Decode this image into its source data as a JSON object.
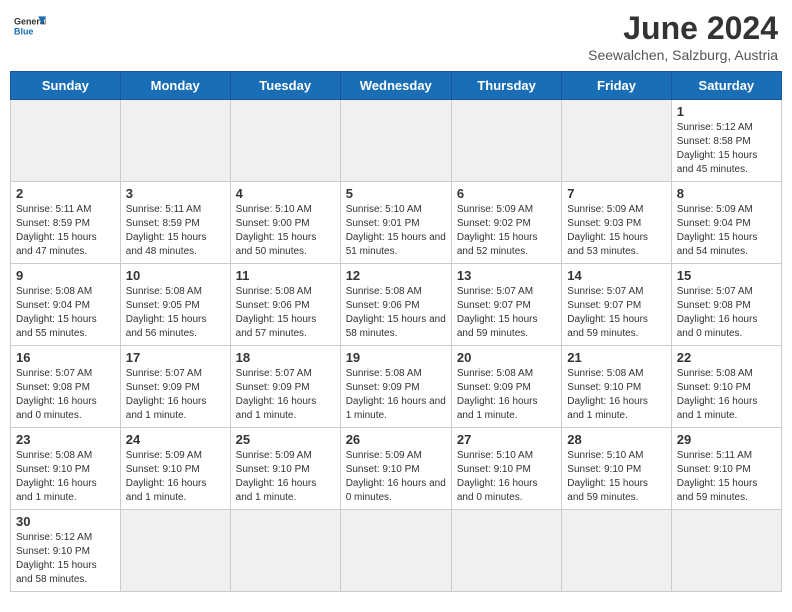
{
  "header": {
    "logo_general": "General",
    "logo_blue": "Blue",
    "month_title": "June 2024",
    "location": "Seewalchen, Salzburg, Austria"
  },
  "days_of_week": [
    "Sunday",
    "Monday",
    "Tuesday",
    "Wednesday",
    "Thursday",
    "Friday",
    "Saturday"
  ],
  "weeks": [
    [
      {
        "day": "",
        "empty": true
      },
      {
        "day": "",
        "empty": true
      },
      {
        "day": "",
        "empty": true
      },
      {
        "day": "",
        "empty": true
      },
      {
        "day": "",
        "empty": true
      },
      {
        "day": "",
        "empty": true
      },
      {
        "day": "1",
        "sunrise": "5:12 AM",
        "sunset": "8:58 PM",
        "daylight": "15 hours and 45 minutes."
      }
    ],
    [
      {
        "day": "2",
        "sunrise": "5:11 AM",
        "sunset": "8:59 PM",
        "daylight": "15 hours and 47 minutes."
      },
      {
        "day": "3",
        "sunrise": "5:11 AM",
        "sunset": "8:59 PM",
        "daylight": "15 hours and 48 minutes."
      },
      {
        "day": "4",
        "sunrise": "5:10 AM",
        "sunset": "9:00 PM",
        "daylight": "15 hours and 50 minutes."
      },
      {
        "day": "5",
        "sunrise": "5:10 AM",
        "sunset": "9:01 PM",
        "daylight": "15 hours and 51 minutes."
      },
      {
        "day": "6",
        "sunrise": "5:09 AM",
        "sunset": "9:02 PM",
        "daylight": "15 hours and 52 minutes."
      },
      {
        "day": "7",
        "sunrise": "5:09 AM",
        "sunset": "9:03 PM",
        "daylight": "15 hours and 53 minutes."
      },
      {
        "day": "8",
        "sunrise": "5:09 AM",
        "sunset": "9:04 PM",
        "daylight": "15 hours and 54 minutes."
      }
    ],
    [
      {
        "day": "9",
        "sunrise": "5:08 AM",
        "sunset": "9:04 PM",
        "daylight": "15 hours and 55 minutes."
      },
      {
        "day": "10",
        "sunrise": "5:08 AM",
        "sunset": "9:05 PM",
        "daylight": "15 hours and 56 minutes."
      },
      {
        "day": "11",
        "sunrise": "5:08 AM",
        "sunset": "9:06 PM",
        "daylight": "15 hours and 57 minutes."
      },
      {
        "day": "12",
        "sunrise": "5:08 AM",
        "sunset": "9:06 PM",
        "daylight": "15 hours and 58 minutes."
      },
      {
        "day": "13",
        "sunrise": "5:07 AM",
        "sunset": "9:07 PM",
        "daylight": "15 hours and 59 minutes."
      },
      {
        "day": "14",
        "sunrise": "5:07 AM",
        "sunset": "9:07 PM",
        "daylight": "15 hours and 59 minutes."
      },
      {
        "day": "15",
        "sunrise": "5:07 AM",
        "sunset": "9:08 PM",
        "daylight": "16 hours and 0 minutes."
      }
    ],
    [
      {
        "day": "16",
        "sunrise": "5:07 AM",
        "sunset": "9:08 PM",
        "daylight": "16 hours and 0 minutes."
      },
      {
        "day": "17",
        "sunrise": "5:07 AM",
        "sunset": "9:09 PM",
        "daylight": "16 hours and 1 minute."
      },
      {
        "day": "18",
        "sunrise": "5:07 AM",
        "sunset": "9:09 PM",
        "daylight": "16 hours and 1 minute."
      },
      {
        "day": "19",
        "sunrise": "5:08 AM",
        "sunset": "9:09 PM",
        "daylight": "16 hours and 1 minute."
      },
      {
        "day": "20",
        "sunrise": "5:08 AM",
        "sunset": "9:09 PM",
        "daylight": "16 hours and 1 minute."
      },
      {
        "day": "21",
        "sunrise": "5:08 AM",
        "sunset": "9:10 PM",
        "daylight": "16 hours and 1 minute."
      },
      {
        "day": "22",
        "sunrise": "5:08 AM",
        "sunset": "9:10 PM",
        "daylight": "16 hours and 1 minute."
      }
    ],
    [
      {
        "day": "23",
        "sunrise": "5:08 AM",
        "sunset": "9:10 PM",
        "daylight": "16 hours and 1 minute."
      },
      {
        "day": "24",
        "sunrise": "5:09 AM",
        "sunset": "9:10 PM",
        "daylight": "16 hours and 1 minute."
      },
      {
        "day": "25",
        "sunrise": "5:09 AM",
        "sunset": "9:10 PM",
        "daylight": "16 hours and 1 minute."
      },
      {
        "day": "26",
        "sunrise": "5:09 AM",
        "sunset": "9:10 PM",
        "daylight": "16 hours and 0 minutes."
      },
      {
        "day": "27",
        "sunrise": "5:10 AM",
        "sunset": "9:10 PM",
        "daylight": "16 hours and 0 minutes."
      },
      {
        "day": "28",
        "sunrise": "5:10 AM",
        "sunset": "9:10 PM",
        "daylight": "15 hours and 59 minutes."
      },
      {
        "day": "29",
        "sunrise": "5:11 AM",
        "sunset": "9:10 PM",
        "daylight": "15 hours and 59 minutes."
      }
    ],
    [
      {
        "day": "30",
        "sunrise": "5:12 AM",
        "sunset": "9:10 PM",
        "daylight": "15 hours and 58 minutes."
      },
      {
        "day": "",
        "empty": true
      },
      {
        "day": "",
        "empty": true
      },
      {
        "day": "",
        "empty": true
      },
      {
        "day": "",
        "empty": true
      },
      {
        "day": "",
        "empty": true
      },
      {
        "day": "",
        "empty": true
      }
    ]
  ]
}
